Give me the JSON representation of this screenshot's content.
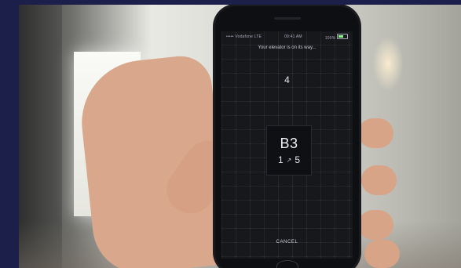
{
  "status_bar": {
    "carrier": "••••• Vodafone LTE",
    "time": "09:41 AM",
    "battery": "100%"
  },
  "elevator_screen": {
    "message": "Your elevator is on its way...",
    "next_floor": "4",
    "elevator_id": "B3",
    "from_floor": "1",
    "arrow": "↗",
    "to_floor": "5",
    "cancel_label": "CANCEL"
  }
}
